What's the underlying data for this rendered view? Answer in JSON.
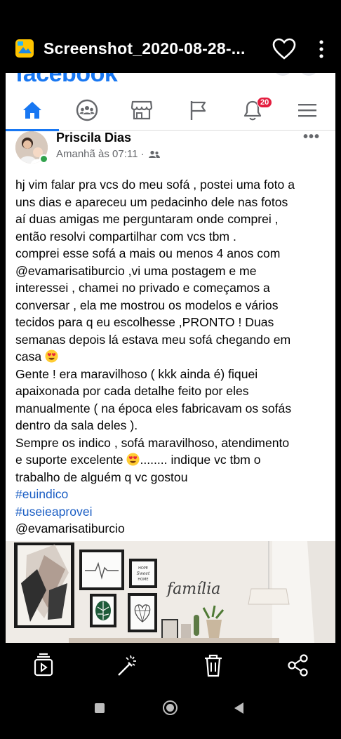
{
  "viewer": {
    "title": "Screenshot_2020-08-28-...",
    "icons": [
      "gallery-icon",
      "heart-icon",
      "more-vertical-icon"
    ]
  },
  "facebook": {
    "logo_text": "facebook",
    "nav": {
      "items": [
        "home-icon",
        "groups-icon",
        "marketplace-icon",
        "pages-flag-icon",
        "notifications-bell-icon",
        "menu-icon"
      ],
      "notifications_count": "20"
    },
    "post": {
      "author": "Priscila Dias",
      "time": "Amanhã às 07:11 ·",
      "options": "•••",
      "lines": [
        "hj vim falar pra vcs do meu sofá , postei uma foto a",
        "uns dias e apareceu um pedacinho dele  nas fotos",
        "aí duas amigas me perguntaram onde comprei ,",
        "então resolvi compartilhar com vcs tbm .",
        "comprei esse sofá a mais ou menos 4 anos com",
        "@evamarisatiburcio ,vi uma postagem e me",
        "interessei , chamei  no privado e  começamos a",
        "conversar , ela me mostrou os modelos e vários",
        "tecidos  para q eu escolhesse ,PRONTO ! Duas",
        "semanas depois lá estava meu sofá  chegando em"
      ],
      "line_casa": "casa",
      "lines2": [
        "Gente ! era maravilhoso ( kkk ainda é) fiquei",
        "apaixonada por cada detalhe feito por eles",
        "manualmente ( na época eles fabricavam os sofás",
        "dentro da sala deles ).",
        "Sempre os indico   , sofá  maravilhoso, atendimento"
      ],
      "line_suporte_a": "e suporte excelente ",
      "line_suporte_b": "........ indique vc tbm o",
      "line_last": "trabalho de alguém q vc  gostou",
      "hashtags": [
        "#euindico",
        "#useieaprovei"
      ],
      "mention": "@evamarisatiburcio",
      "photo": {
        "wall_script": "família",
        "frame_text_1": "HOPE",
        "frame_text_2": "Sweet",
        "frame_text_3": "HOME"
      }
    }
  },
  "viewer_actions": [
    "slideshow-icon",
    "edit-wand-icon",
    "delete-trash-icon",
    "share-icon"
  ],
  "colors": {
    "facebook_blue": "#1877f2",
    "badge_red": "#e41e3f",
    "online_green": "#31a24c",
    "hashtag_blue": "#1c5fc4"
  }
}
